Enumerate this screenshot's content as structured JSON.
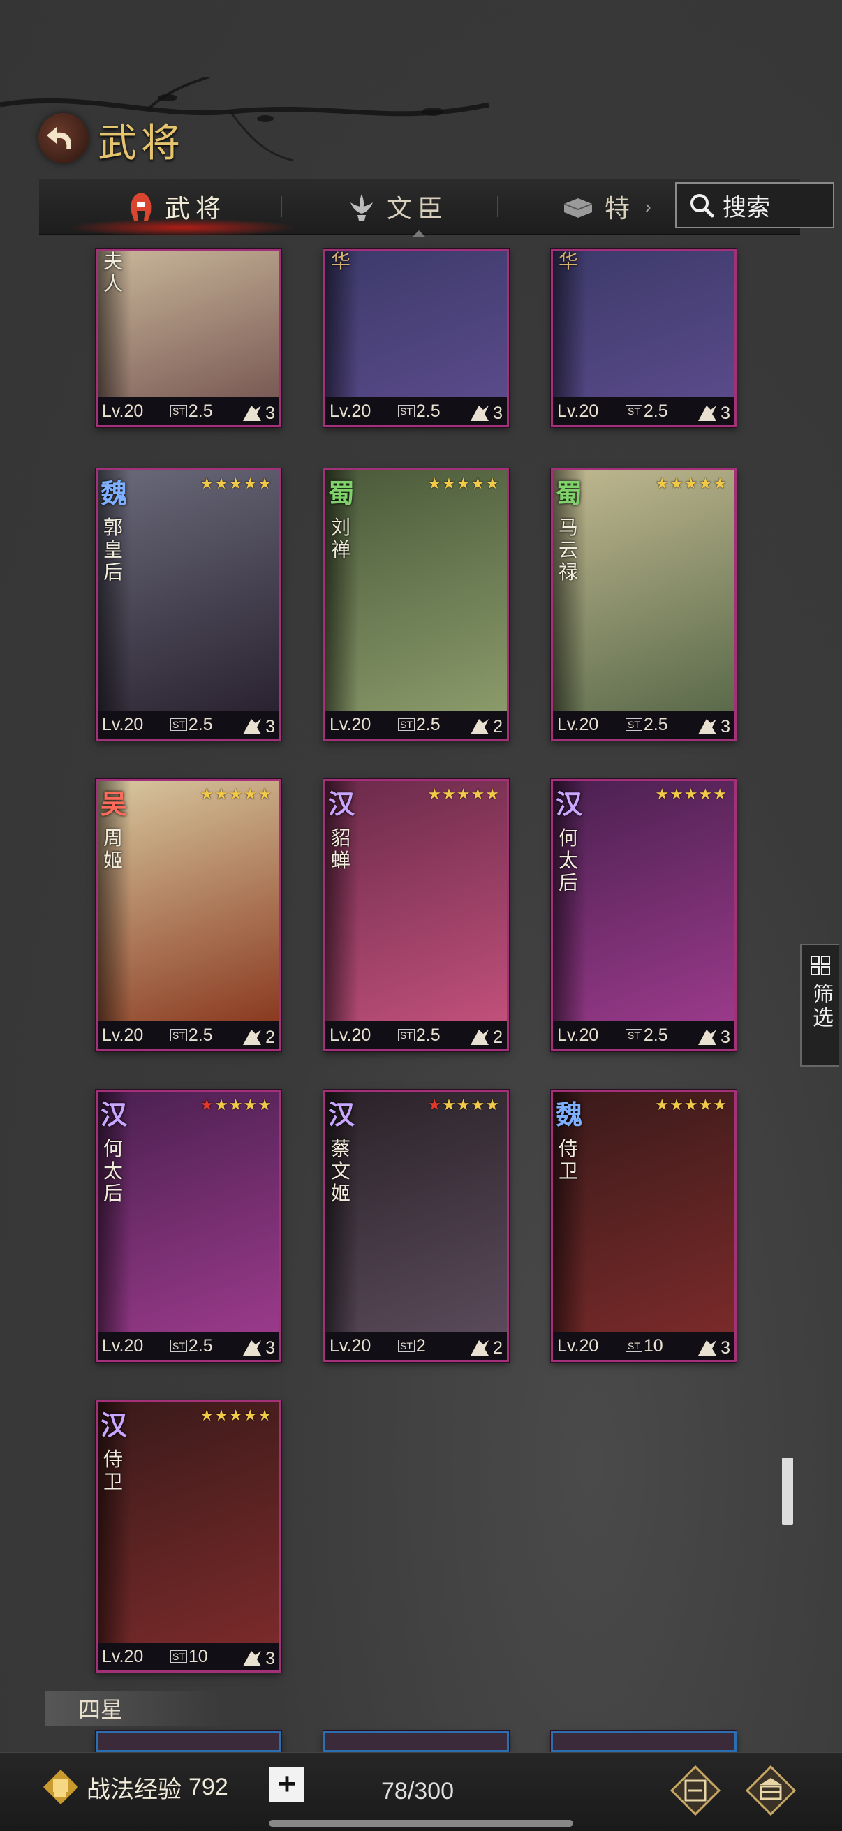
{
  "header": {
    "title": "武将"
  },
  "tabs": [
    {
      "label": "武将",
      "active": true
    },
    {
      "label": "文臣",
      "active": false
    },
    {
      "label": "特",
      "active": false
    }
  ],
  "search": {
    "label": "搜索"
  },
  "filter": {
    "label": "筛选"
  },
  "section": {
    "label": "四星"
  },
  "factionColors": {
    "魏": "#7fb0ff",
    "蜀": "#7fd36a",
    "吴": "#ff6b5a",
    "汉": "#c9a6ff",
    "华": "#d8b070"
  },
  "cards": [
    {
      "faction": "",
      "name": "夫人",
      "level": "Lv.20",
      "cost": "2.5",
      "arm": "3",
      "clipped": true
    },
    {
      "faction": "",
      "name": "华",
      "level": "Lv.20",
      "cost": "2.5",
      "arm": "3",
      "clipped": true
    },
    {
      "faction": "",
      "name": "华",
      "level": "Lv.20",
      "cost": "2.5",
      "arm": "3",
      "clipped": true
    },
    {
      "faction": "魏",
      "name": "郭皇后",
      "level": "Lv.20",
      "cost": "2.5",
      "arm": "3",
      "stars": 5,
      "redStars": 0
    },
    {
      "faction": "蜀",
      "name": "刘禅",
      "level": "Lv.20",
      "cost": "2.5",
      "arm": "2",
      "stars": 5,
      "redStars": 0
    },
    {
      "faction": "蜀",
      "name": "马云禄",
      "level": "Lv.20",
      "cost": "2.5",
      "arm": "3",
      "stars": 5,
      "redStars": 0
    },
    {
      "faction": "吴",
      "name": "周姬",
      "level": "Lv.20",
      "cost": "2.5",
      "arm": "2",
      "stars": 5,
      "redStars": 0
    },
    {
      "faction": "汉",
      "name": "貂蝉",
      "level": "Lv.20",
      "cost": "2.5",
      "arm": "2",
      "stars": 5,
      "redStars": 0
    },
    {
      "faction": "汉",
      "name": "何太后",
      "level": "Lv.20",
      "cost": "2.5",
      "arm": "3",
      "stars": 5,
      "redStars": 0
    },
    {
      "faction": "汉",
      "name": "何太后",
      "level": "Lv.20",
      "cost": "2.5",
      "arm": "3",
      "stars": 5,
      "redStars": 1
    },
    {
      "faction": "汉",
      "name": "蔡文姬",
      "level": "Lv.20",
      "cost": "2",
      "arm": "2",
      "stars": 5,
      "redStars": 1
    },
    {
      "faction": "魏",
      "name": "侍卫",
      "level": "Lv.20",
      "cost": "10",
      "arm": "3",
      "stars": 5,
      "redStars": 0
    },
    {
      "faction": "汉",
      "name": "侍卫",
      "level": "Lv.20",
      "cost": "10",
      "arm": "3",
      "stars": 5,
      "redStars": 0
    }
  ],
  "footer": {
    "xp_label": "战法经验",
    "xp_value": "792",
    "plus": "+",
    "count": "78/300"
  }
}
